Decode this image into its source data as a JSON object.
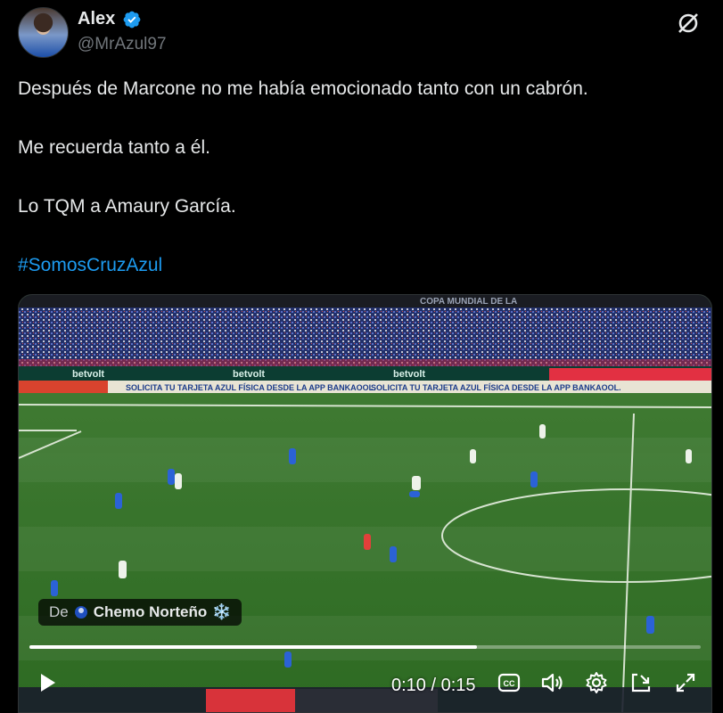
{
  "tweet": {
    "author_name": "Alex",
    "author_handle": "@MrAzul97",
    "lines": [
      "Después de Marcone no me había emocionado tanto con un cabrón.",
      "Me recuerda tanto a él.",
      "Lo TQM a Amaury García."
    ],
    "hashtag": "#SomosCruzAzul"
  },
  "video": {
    "attribution_prefix": "De",
    "attribution_name": "Chemo Norteño",
    "attribution_emoji": "❄️",
    "current_time": "0:10",
    "separator": " / ",
    "duration": "0:15",
    "progress": 0.667,
    "banner_top": "COPA MUNDIAL DE LA",
    "banner_ad": "SOLICITA TU TARJETA AZUL FÍSICA DESDE LA APP BANKAOOL.",
    "board_labels": [
      "betvolt",
      "betvolt",
      "betvolt"
    ]
  },
  "colors": {
    "background": "#000000",
    "text": "#e7e9ea",
    "secondary": "#71767b",
    "link": "#1d9bf0",
    "verified": "#1d9bf0"
  }
}
